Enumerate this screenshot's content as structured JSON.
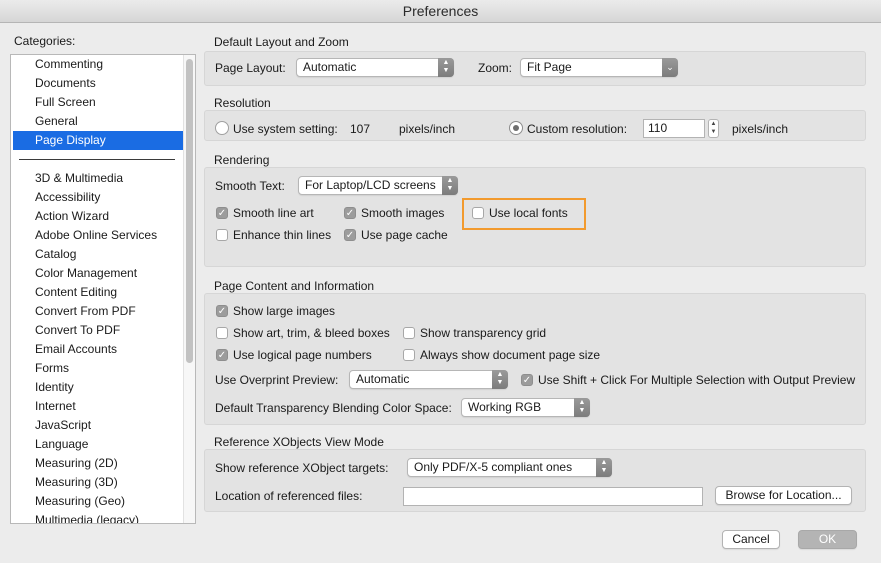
{
  "window": {
    "title": "Preferences"
  },
  "categories": {
    "label": "Categories:",
    "group1": [
      "Commenting",
      "Documents",
      "Full Screen",
      "General",
      "Page Display"
    ],
    "group2": [
      "3D & Multimedia",
      "Accessibility",
      "Action Wizard",
      "Adobe Online Services",
      "Catalog",
      "Color Management",
      "Content Editing",
      "Convert From PDF",
      "Convert To PDF",
      "Email Accounts",
      "Forms",
      "Identity",
      "Internet",
      "JavaScript",
      "Language",
      "Measuring (2D)",
      "Measuring (3D)",
      "Measuring (Geo)",
      "Multimedia (legacy)"
    ],
    "selected": "Page Display"
  },
  "layout_zoom": {
    "title": "Default Layout and Zoom",
    "page_layout_label": "Page Layout:",
    "page_layout_value": "Automatic",
    "zoom_label": "Zoom:",
    "zoom_value": "Fit Page"
  },
  "resolution": {
    "title": "Resolution",
    "system_label": "Use system setting:",
    "system_value": "107",
    "system_unit": "pixels/inch",
    "custom_label": "Custom resolution:",
    "custom_value": "110",
    "custom_unit": "pixels/inch",
    "selected": "custom"
  },
  "rendering": {
    "title": "Rendering",
    "smooth_text_label": "Smooth Text:",
    "smooth_text_value": "For Laptop/LCD screens",
    "smooth_line_art": {
      "label": "Smooth line art",
      "checked": true
    },
    "smooth_images": {
      "label": "Smooth images",
      "checked": true
    },
    "use_local_fonts": {
      "label": "Use local fonts",
      "checked": false
    },
    "enhance_thin_lines": {
      "label": "Enhance thin lines",
      "checked": false
    },
    "use_page_cache": {
      "label": "Use page cache",
      "checked": true
    },
    "highlight_color": "#f29a2e"
  },
  "page_content": {
    "title": "Page Content and Information",
    "show_large_images": {
      "label": "Show large images",
      "checked": true
    },
    "show_art_trim": {
      "label": "Show art, trim, & bleed boxes",
      "checked": false
    },
    "show_transparency_grid": {
      "label": "Show transparency grid",
      "checked": false
    },
    "use_logical_page_numbers": {
      "label": "Use logical page numbers",
      "checked": true
    },
    "always_show_doc_page_size": {
      "label": "Always show document page size",
      "checked": false
    },
    "overprint_label": "Use Overprint Preview:",
    "overprint_value": "Automatic",
    "shift_click": {
      "label": "Use Shift + Click For Multiple Selection with Output Preview",
      "checked": true
    },
    "blending_label": "Default Transparency Blending Color Space:",
    "blending_value": "Working RGB"
  },
  "xobjects": {
    "title": "Reference XObjects View Mode",
    "targets_label": "Show reference XObject targets:",
    "targets_value": "Only PDF/X-5 compliant ones",
    "location_label": "Location of referenced files:",
    "location_value": "",
    "browse_label": "Browse for Location..."
  },
  "footer": {
    "cancel_label": "Cancel",
    "ok_label": "OK"
  },
  "colors": {
    "selection": "#1a6ce3",
    "highlight": "#f29a2e"
  }
}
